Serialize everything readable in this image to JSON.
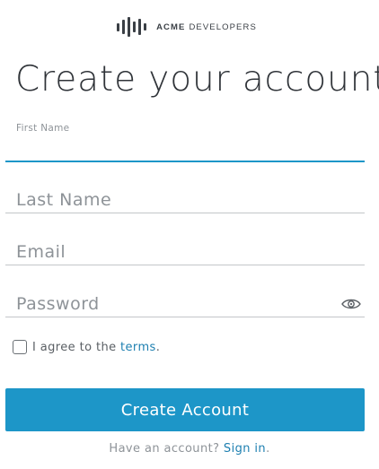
{
  "brand": {
    "name_bold": "ACME",
    "name_rest": "DEVELOPERS",
    "logo_icon": "sound-wave-bars-icon"
  },
  "page_title": "Create your account",
  "form": {
    "first_name": {
      "label": "First Name",
      "value": "",
      "placeholder": ""
    },
    "last_name": {
      "value": "",
      "placeholder": "Last Name"
    },
    "email": {
      "value": "",
      "placeholder": "Email"
    },
    "password": {
      "value": "",
      "placeholder": "Password",
      "toggle_icon": "eye-icon"
    },
    "agree": {
      "checked": false,
      "prefix": "I agree to the ",
      "link_text": "terms",
      "suffix": "."
    },
    "submit_label": "Create Account"
  },
  "footer": {
    "prompt": "Have an account? ",
    "link_text": "Sign in",
    "suffix": "."
  },
  "colors": {
    "accent": "#1d96c8",
    "link": "#1d7fb0",
    "text_dark": "#2f3338",
    "text_muted": "#8e9398",
    "divider": "#c3c6c9"
  }
}
